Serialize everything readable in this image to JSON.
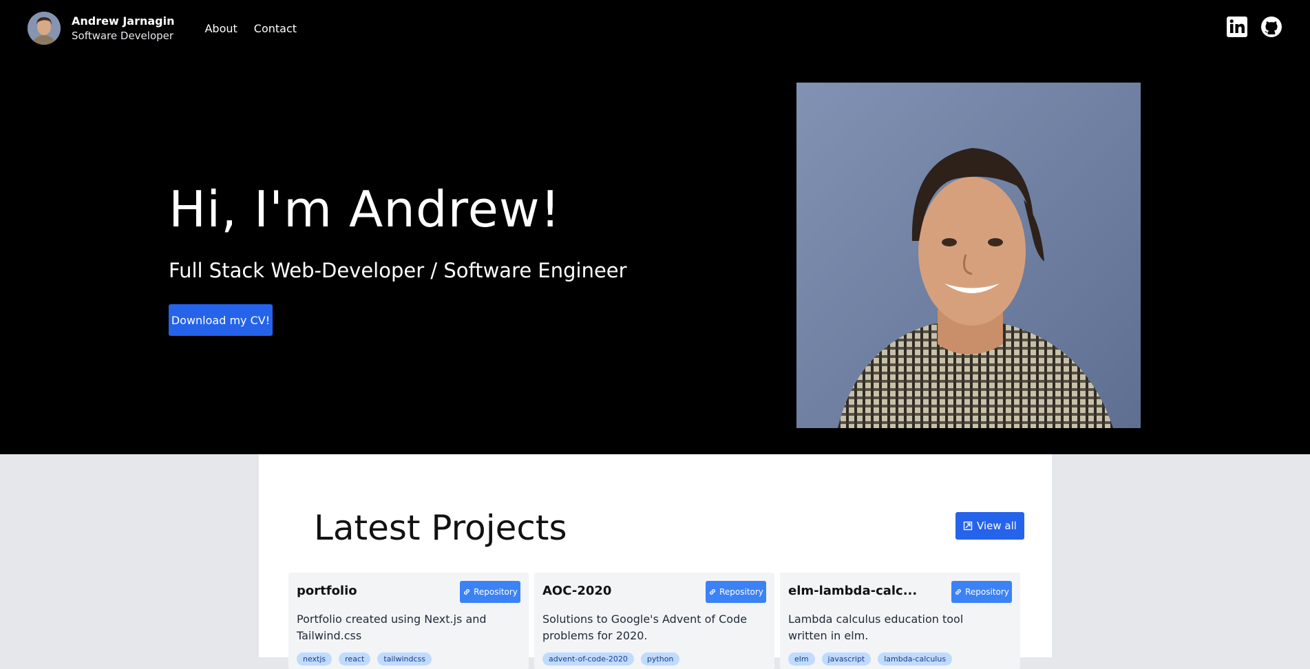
{
  "header": {
    "name": "Andrew Jarnagin",
    "role": "Software Developer",
    "nav": [
      {
        "label": "About"
      },
      {
        "label": "Contact"
      }
    ],
    "social": [
      {
        "icon": "linkedin-icon"
      },
      {
        "icon": "github-icon"
      }
    ]
  },
  "hero": {
    "title": "Hi, I'm Andrew!",
    "subtitle": "Full Stack Web-Developer / Software Engineer",
    "cv_button": "Download my CV!"
  },
  "projects": {
    "title": "Latest Projects",
    "view_all": "View all",
    "repo_label": "Repository",
    "items": [
      {
        "name": "portfolio",
        "description": "Portfolio created using Next.js and Tailwind.css",
        "tags": [
          "nextjs",
          "react",
          "tailwindcss"
        ]
      },
      {
        "name": "AOC-2020",
        "description": "Solutions to Google's Advent of Code problems for 2020.",
        "tags": [
          "advent-of-code-2020",
          "python"
        ]
      },
      {
        "name": "elm-lambda-calc...",
        "description": "Lambda calculus education tool written in elm.",
        "tags": [
          "elm",
          "javascript",
          "lambda-calculus"
        ]
      }
    ]
  },
  "colors": {
    "nav_bg": "#000000",
    "accent": "#2563eb",
    "page_bg": "#e5e7eb",
    "card_bg": "#f3f4f6",
    "tag_bg": "#bfdbfe"
  }
}
